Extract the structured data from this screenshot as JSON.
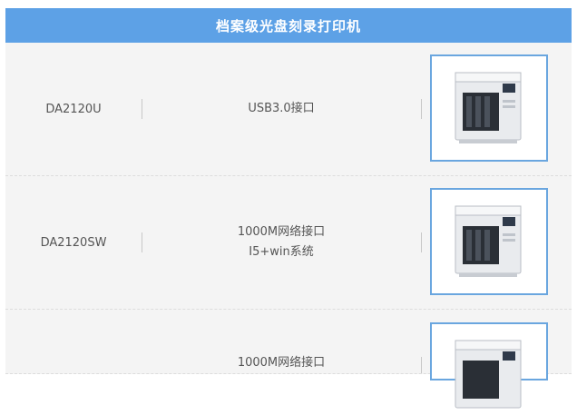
{
  "header": {
    "title": "档案级光盘刻录打印机"
  },
  "rows": [
    {
      "model": "DA2120U",
      "spec": [
        "USB3.0接口"
      ],
      "image": "printer-image"
    },
    {
      "model": "DA2120SW",
      "spec": [
        "1000M网络接口",
        "I5+win系统"
      ],
      "image": "printer-image"
    },
    {
      "model": "",
      "spec": [
        "1000M网络接口"
      ],
      "image": "printer-image"
    }
  ],
  "colors": {
    "header_bg": "#5da1e6",
    "row_bg": "#f4f4f4",
    "thumb_border": "#6aa6df"
  }
}
